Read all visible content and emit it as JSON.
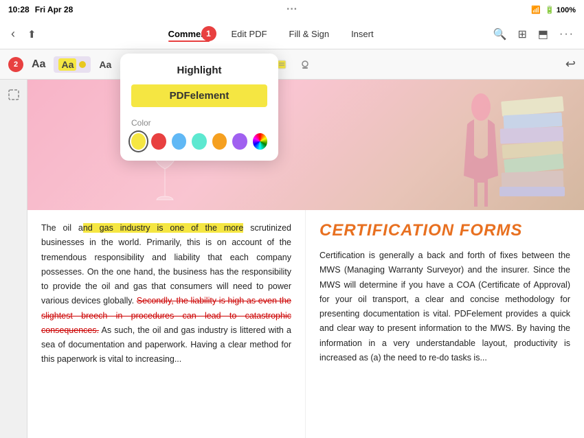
{
  "statusBar": {
    "time": "10:28",
    "day": "Fri Apr 28",
    "wifi": "📶",
    "battery": "100%"
  },
  "toolbar": {
    "back": "‹",
    "share": "⬆",
    "tabs": [
      {
        "label": "Comment",
        "active": true
      },
      {
        "label": "Edit PDF",
        "active": false
      },
      {
        "label": "Fill & Sign",
        "active": false
      },
      {
        "label": "Insert",
        "active": false
      }
    ],
    "more": "···",
    "search": "🔍",
    "grid": "⊞",
    "airplay": "⬒",
    "ellipsis": "···"
  },
  "commentToolbar": {
    "textTool1": "Aa",
    "highlightTool": "Aa",
    "textTool2": "Aa",
    "textTool3": "Aa",
    "textTool4": "Aa",
    "undo": "↩"
  },
  "badge1": "1",
  "badge2": "2",
  "highlightPopup": {
    "title": "Highlight",
    "previewText": "PDFelement",
    "colorLabel": "Color",
    "swatches": [
      "#f5e642",
      "#e84040",
      "#60b8f5",
      "#5de8d0",
      "#f5a020",
      "#a060f0",
      "#f04090"
    ]
  },
  "content": {
    "leftText1": "The oil and ",
    "leftTextHighlighted": "nd gas industry is one of the more",
    "leftText2": " scrutinized businesses in the world. Primarily, this is on account of the tremendous responsibility and liability that each company possesses. On the one hand, the business has the responsibility to provide the oil and gas that consumers will need to power various devices globally. ",
    "strikethroughText": "Secondly, the liability is high as even the slightest breech in procedures can lead to catastrophic consequences.",
    "leftText3": " As such, the oil and gas industry is littered with a sea of documentation and paperwork. Having a clear method for this paperwork is vital to increasing...",
    "certTitle": "CERTIFICATION FORMS",
    "rightText": "Certification is generally a back and forth of fixes between the MWS (Managing Warranty Surveyor) and the insurer. Since the MWS will determine if you have a COA (Certificate of Approval) for your oil transport, a clear and concise methodology for presenting documentation is vital. PDFelement provides a quick and clear way to present information to the MWS. By having the information in a very understandable layout, productivity is increased as (a) the need to re-do tasks is..."
  }
}
